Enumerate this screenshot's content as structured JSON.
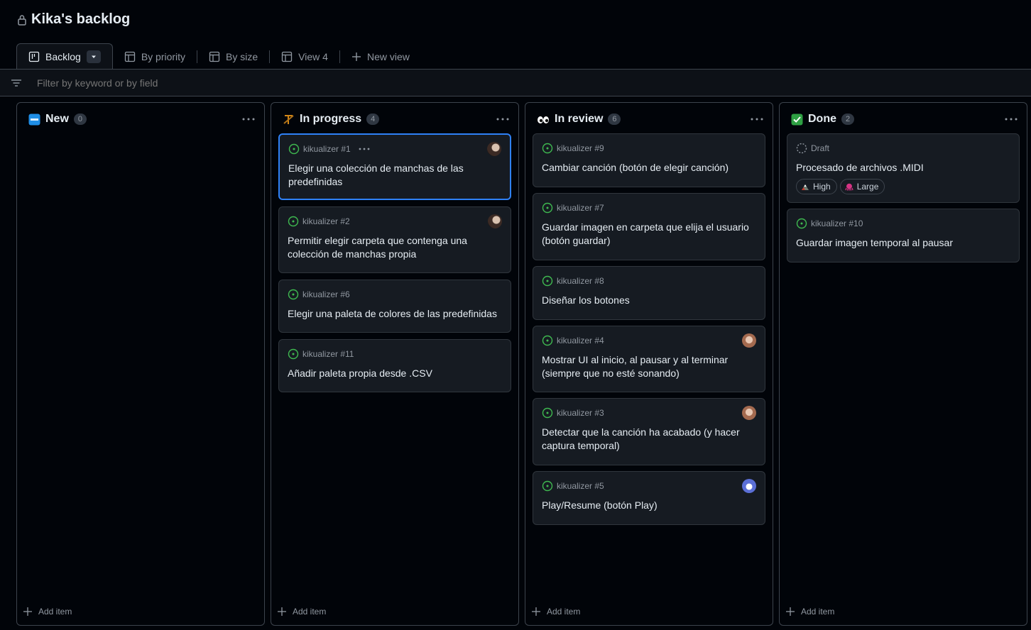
{
  "header": {
    "title": "Kika's backlog"
  },
  "tabs": [
    {
      "label": "Backlog",
      "icon": "board-icon",
      "active": true
    },
    {
      "label": "By priority",
      "icon": "table-icon"
    },
    {
      "label": "By size",
      "icon": "table-icon"
    },
    {
      "label": "View 4",
      "icon": "table-icon"
    },
    {
      "label": "New view",
      "icon": "plus-icon"
    }
  ],
  "filter": {
    "placeholder": "Filter by keyword or by field"
  },
  "colors": {
    "open_issue": "#3fb950",
    "selected_border": "#2f81f7",
    "background": "#010409",
    "card": "#161b22"
  },
  "columns": [
    {
      "title": "New",
      "emoji": "new-badge-icon",
      "count": "0",
      "add_label": "Add item",
      "cards": []
    },
    {
      "title": "In progress",
      "emoji": "hammer-pick-icon",
      "count": "4",
      "add_label": "Add item",
      "cards": [
        {
          "ref": "kikualizer #1",
          "title": "Elegir una colección de manchas de las predefinidas",
          "avatar": true,
          "selected": true
        },
        {
          "ref": "kikualizer #2",
          "title": "Permitir elegir carpeta que contenga una colección de manchas propia",
          "avatar": true
        },
        {
          "ref": "kikualizer #6",
          "title": "Elegir una paleta de colores de las predefinidas"
        },
        {
          "ref": "kikualizer #11",
          "title": "Añadir paleta propia desde .CSV"
        }
      ]
    },
    {
      "title": "In review",
      "emoji": "eyes-icon",
      "count": "6",
      "add_label": "Add item",
      "cards": [
        {
          "ref": "kikualizer #9",
          "title": "Cambiar canción (botón de elegir canción)"
        },
        {
          "ref": "kikualizer #7",
          "title": "Guardar imagen en carpeta que elija el usuario (botón guardar)"
        },
        {
          "ref": "kikualizer #8",
          "title": "Diseñar los botones"
        },
        {
          "ref": "kikualizer #4",
          "title": "Mostrar UI al inicio, al pausar y al terminar (siempre que no esté sonando)",
          "avatar": true
        },
        {
          "ref": "kikualizer #3",
          "title": "Detectar que la canción ha acabado (y hacer captura temporal)",
          "avatar": true
        },
        {
          "ref": "kikualizer #5",
          "title": "Play/Resume (botón Play)",
          "avatar": true
        }
      ]
    },
    {
      "title": "Done",
      "emoji": "check-box-icon",
      "count": "2",
      "add_label": "Add item",
      "cards": [
        {
          "ref": "Draft",
          "title": "Procesado de archivos .MIDI",
          "draft": true,
          "labels": [
            "High",
            "Large"
          ]
        },
        {
          "ref": "kikualizer #10",
          "title": "Guardar imagen temporal al pausar"
        }
      ]
    }
  ]
}
